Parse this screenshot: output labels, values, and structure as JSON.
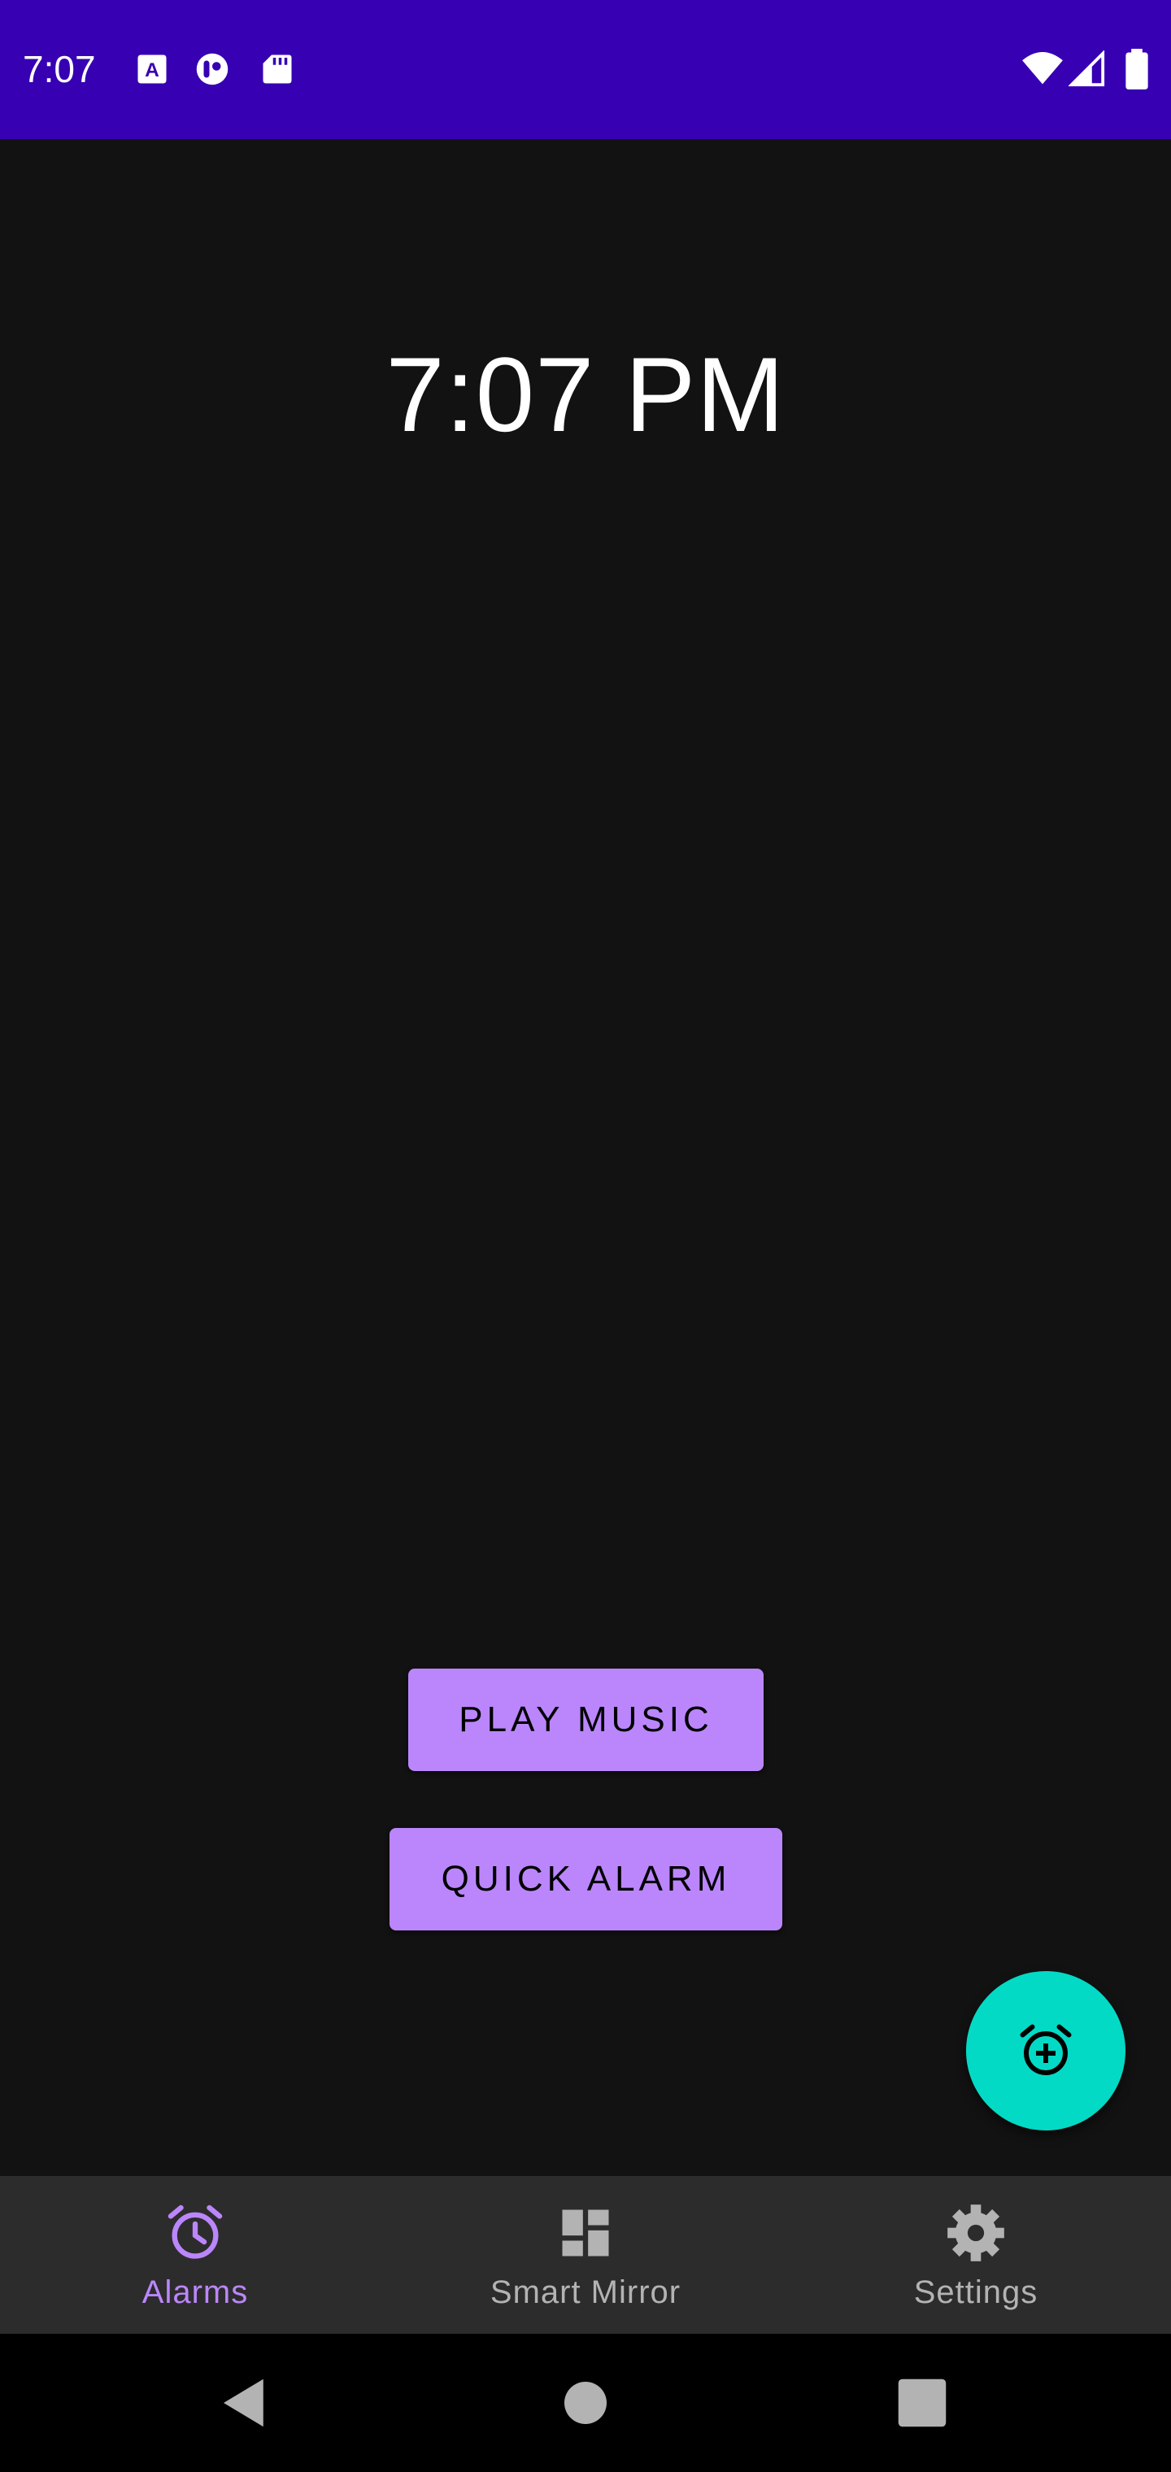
{
  "colors": {
    "status_bar": "#3700b3",
    "background": "#121212",
    "primary": "#bb86fc",
    "fab": "#03dac5",
    "bottom_nav": "#2c2c2c",
    "nav_inactive": "#b3b3b3",
    "system_nav": "#000000"
  },
  "status_bar": {
    "time": "7:07",
    "left_icons": [
      "font-a-icon",
      "media-icon",
      "sd-card-icon"
    ],
    "right_icons": [
      "wifi-icon",
      "cellular-signal-icon",
      "battery-icon"
    ]
  },
  "clock": {
    "time": "7:07 PM"
  },
  "actions": {
    "play_music": "PLAY MUSIC",
    "quick_alarm": "QUICK ALARM"
  },
  "fab": {
    "icon": "add-alarm-icon"
  },
  "bottom_nav": {
    "items": [
      {
        "label": "Alarms",
        "icon": "alarm-clock-icon",
        "active": true
      },
      {
        "label": "Smart Mirror",
        "icon": "dashboard-icon",
        "active": false
      },
      {
        "label": "Settings",
        "icon": "gear-icon",
        "active": false
      }
    ]
  },
  "system_nav": {
    "buttons": [
      "back-icon",
      "home-icon",
      "recents-icon"
    ]
  }
}
